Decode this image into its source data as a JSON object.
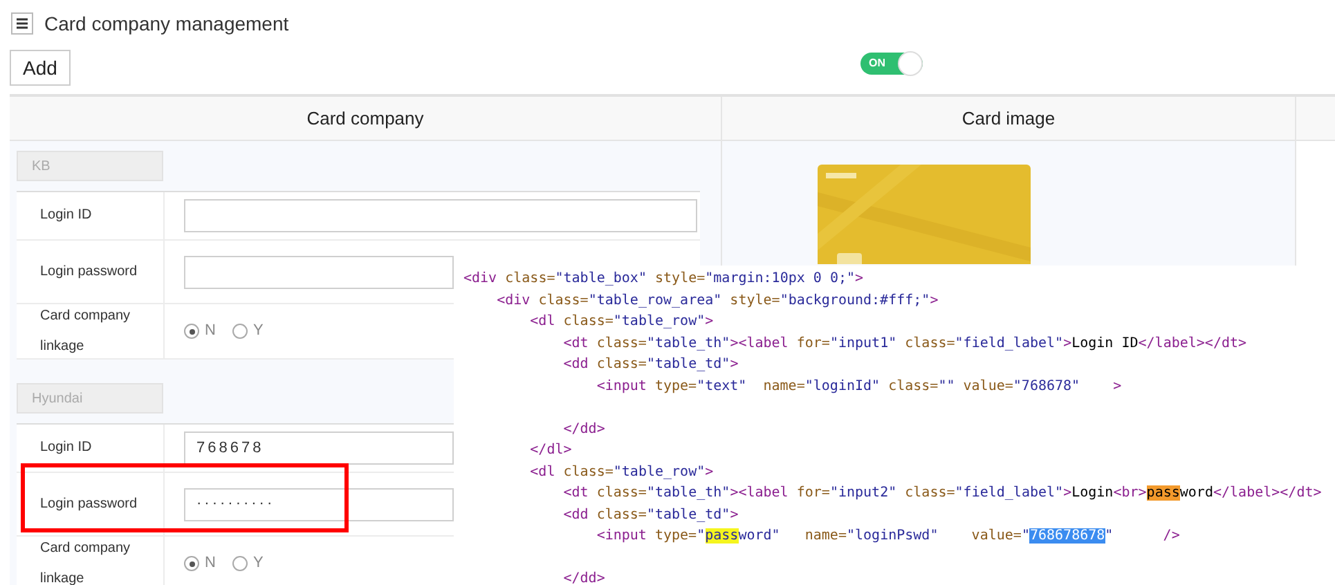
{
  "page": {
    "title": "Card company management"
  },
  "toolbar": {
    "add_button": "Add",
    "toggle": {
      "label": "ON",
      "on": true
    }
  },
  "table": {
    "columns": [
      "Card company",
      "Card image"
    ],
    "companies": [
      {
        "name": "KB",
        "card": {
          "kind": "picture"
        },
        "fields": [
          {
            "kind": "text",
            "label": "Login ID",
            "highlighted": false
          },
          {
            "kind": "password",
            "label": "Login password",
            "highlighted": false
          },
          {
            "kind": "radio",
            "label": "Card company linkage",
            "options": [
              {
                "label": "N",
                "selected": true
              },
              {
                "label": "Y",
                "selected": false
              }
            ]
          }
        ]
      },
      {
        "name": "Hyundai",
        "fields": [
          {
            "kind": "text",
            "label": "Login ID",
            "value": "768678",
            "highlighted": false
          },
          {
            "kind": "password",
            "label": "Login password",
            "value": "··········",
            "highlighted": true
          },
          {
            "kind": "radio",
            "label": "Card company linkage",
            "options": [
              {
                "label": "N",
                "selected": true
              },
              {
                "label": "Y",
                "selected": false
              }
            ]
          }
        ]
      }
    ]
  },
  "code_view": {
    "lines": [
      {
        "tokens": [
          {
            "kind": "tag",
            "t": "<div"
          },
          {
            "kind": "attr",
            "t": " class="
          },
          {
            "kind": "str",
            "t": "\"table_box\""
          },
          {
            "kind": "attr",
            "t": " style="
          },
          {
            "kind": "str",
            "t": "\"margin:10px 0 0;\""
          },
          {
            "kind": "tag",
            "t": ">"
          }
        ]
      },
      {
        "tokens": [
          {
            "kind": "tag",
            "t": "    <div"
          },
          {
            "kind": "attr",
            "t": " class="
          },
          {
            "kind": "str",
            "t": "\"table_row_area\""
          },
          {
            "kind": "attr",
            "t": " style="
          },
          {
            "kind": "str",
            "t": "\"background:#fff;\""
          },
          {
            "kind": "tag",
            "t": ">"
          }
        ]
      },
      {
        "tokens": [
          {
            "kind": "tag",
            "t": "        <dl"
          },
          {
            "kind": "attr",
            "t": " class="
          },
          {
            "kind": "str",
            "t": "\"table_row\""
          },
          {
            "kind": "tag",
            "t": ">"
          }
        ]
      },
      {
        "tokens": [
          {
            "kind": "tag",
            "t": "            <dt"
          },
          {
            "kind": "attr",
            "t": " class="
          },
          {
            "kind": "str",
            "t": "\"table_th\""
          },
          {
            "kind": "tag",
            "t": "><label"
          },
          {
            "kind": "attr",
            "t": " for="
          },
          {
            "kind": "str",
            "t": "\"input1\""
          },
          {
            "kind": "attr",
            "t": " class="
          },
          {
            "kind": "str",
            "t": "\"field_label\""
          },
          {
            "kind": "tag",
            "t": ">"
          },
          {
            "kind": "text",
            "t": "Login ID"
          },
          {
            "kind": "tag",
            "t": "</label></dt>"
          }
        ]
      },
      {
        "tokens": [
          {
            "kind": "tag",
            "t": "            <dd"
          },
          {
            "kind": "attr",
            "t": " class="
          },
          {
            "kind": "str",
            "t": "\"table_td\""
          },
          {
            "kind": "tag",
            "t": ">"
          }
        ]
      },
      {
        "tokens": [
          {
            "kind": "tag",
            "t": "                <input"
          },
          {
            "kind": "attr",
            "t": " type="
          },
          {
            "kind": "str",
            "t": "\"text\""
          },
          {
            "kind": "attr",
            "t": "  name="
          },
          {
            "kind": "str",
            "t": "\"loginId\""
          },
          {
            "kind": "attr",
            "t": " class="
          },
          {
            "kind": "str",
            "t": "\"\""
          },
          {
            "kind": "attr",
            "t": " value="
          },
          {
            "kind": "str",
            "t": "\"768678\""
          },
          {
            "kind": "tag",
            "t": "    >"
          }
        ]
      },
      {
        "kind": "blank"
      },
      {
        "tokens": [
          {
            "kind": "tag",
            "t": "            </dd>"
          }
        ]
      },
      {
        "tokens": [
          {
            "kind": "tag",
            "t": "        </dl>"
          }
        ]
      },
      {
        "tokens": [
          {
            "kind": "tag",
            "t": "        <dl"
          },
          {
            "kind": "attr",
            "t": " class="
          },
          {
            "kind": "str",
            "t": "\"table_row\""
          },
          {
            "kind": "tag",
            "t": ">"
          }
        ]
      },
      {
        "tokens": [
          {
            "kind": "tag",
            "t": "            <dt"
          },
          {
            "kind": "attr",
            "t": " class="
          },
          {
            "kind": "str",
            "t": "\"table_th\""
          },
          {
            "kind": "tag",
            "t": "><label"
          },
          {
            "kind": "attr",
            "t": " for="
          },
          {
            "kind": "str",
            "t": "\"input2\""
          },
          {
            "kind": "attr",
            "t": " class="
          },
          {
            "kind": "str",
            "t": "\"field_label\""
          },
          {
            "kind": "tag",
            "t": ">"
          },
          {
            "kind": "text",
            "t": "Login"
          },
          {
            "kind": "tag",
            "t": "<br>"
          },
          {
            "kind": "match_orange",
            "t": "pass"
          },
          {
            "kind": "text",
            "t": "word"
          },
          {
            "kind": "tag",
            "t": "</label></dt>"
          }
        ]
      },
      {
        "tokens": [
          {
            "kind": "tag",
            "t": "            <dd"
          },
          {
            "kind": "attr",
            "t": " class="
          },
          {
            "kind": "str",
            "t": "\"table_td\""
          },
          {
            "kind": "tag",
            "t": ">"
          }
        ]
      },
      {
        "tokens": [
          {
            "kind": "tag",
            "t": "                <input"
          },
          {
            "kind": "attr",
            "t": " type="
          },
          {
            "kind": "str",
            "t": "\""
          },
          {
            "kind": "match_yellow",
            "t": "pass"
          },
          {
            "kind": "str",
            "t": "word\""
          },
          {
            "kind": "attr",
            "t": "   name="
          },
          {
            "kind": "str",
            "t": "\"loginPswd\""
          },
          {
            "kind": "attr",
            "t": "    value="
          },
          {
            "kind": "str",
            "t": "\""
          },
          {
            "kind": "selection",
            "t": "768678678"
          },
          {
            "kind": "str",
            "t": "\""
          },
          {
            "kind": "tag",
            "t": "      />"
          }
        ]
      },
      {
        "kind": "blank"
      },
      {
        "tokens": [
          {
            "kind": "tag",
            "t": "            </dd>"
          }
        ]
      }
    ]
  }
}
